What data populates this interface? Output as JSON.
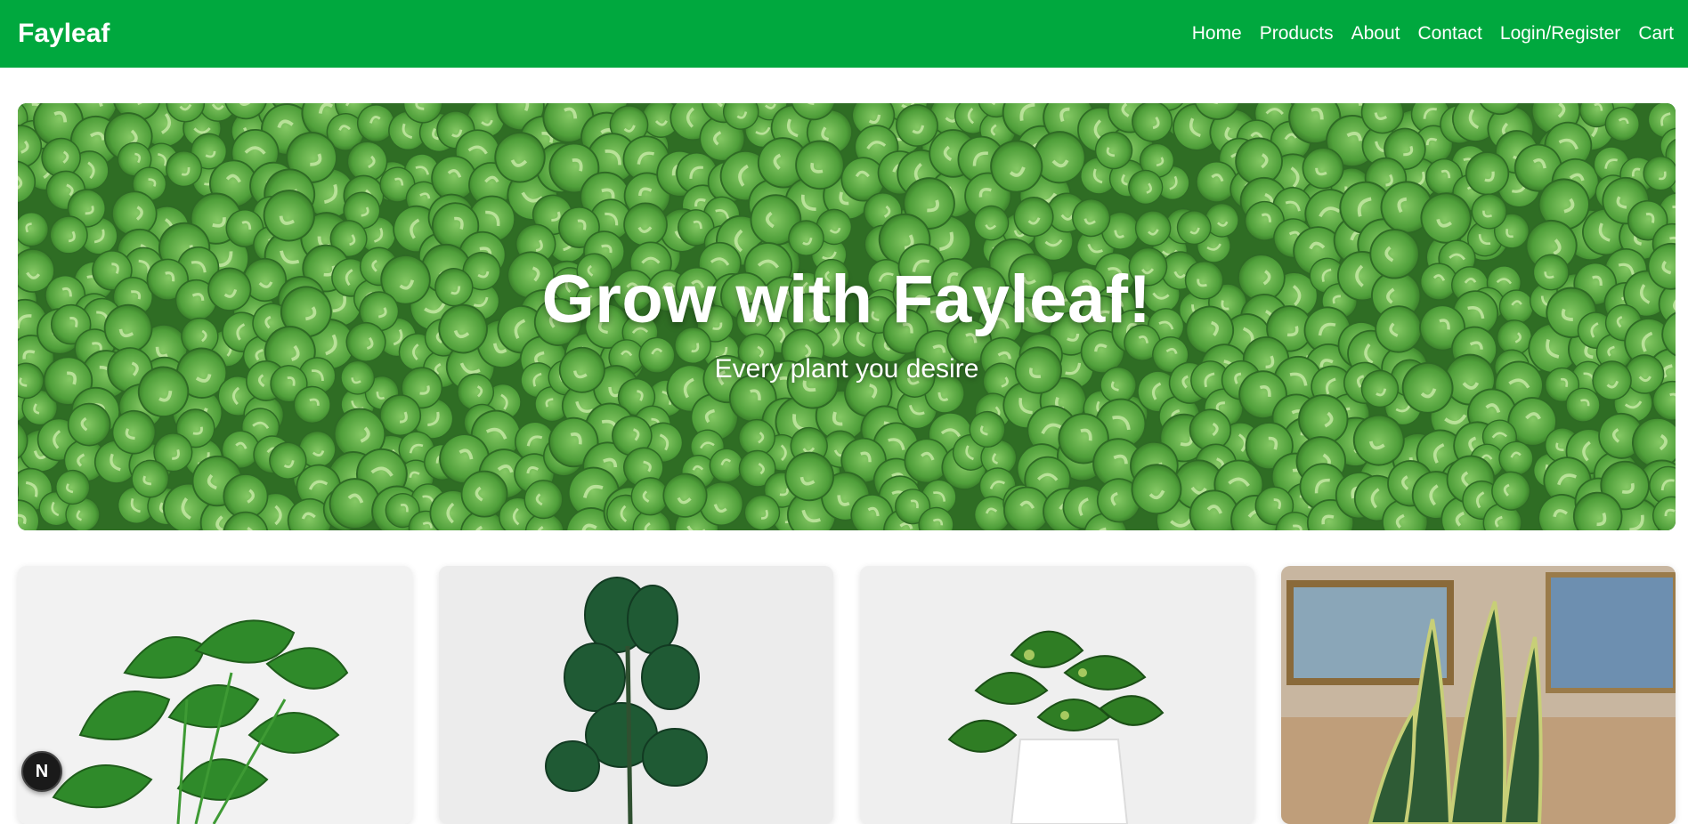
{
  "brand": {
    "name": "Fayleaf"
  },
  "nav": {
    "items": [
      {
        "label": "Home"
      },
      {
        "label": "Products"
      },
      {
        "label": "About"
      },
      {
        "label": "Contact"
      },
      {
        "label": "Login/Register"
      },
      {
        "label": "Cart"
      }
    ]
  },
  "hero": {
    "title": "Grow with Fayleaf!",
    "subtitle": "Every plant you desire",
    "image_icon": "clover-field"
  },
  "products": [
    {
      "image_icon": "monstera-plant"
    },
    {
      "image_icon": "fiddle-leaf-fig-plant"
    },
    {
      "image_icon": "pothos-plant"
    },
    {
      "image_icon": "snake-plant"
    }
  ],
  "dev_badge": {
    "label": "N"
  },
  "colors": {
    "primary": "#00a83e",
    "leaf": "#4a9f38",
    "leaf_light": "#7cc35a"
  }
}
